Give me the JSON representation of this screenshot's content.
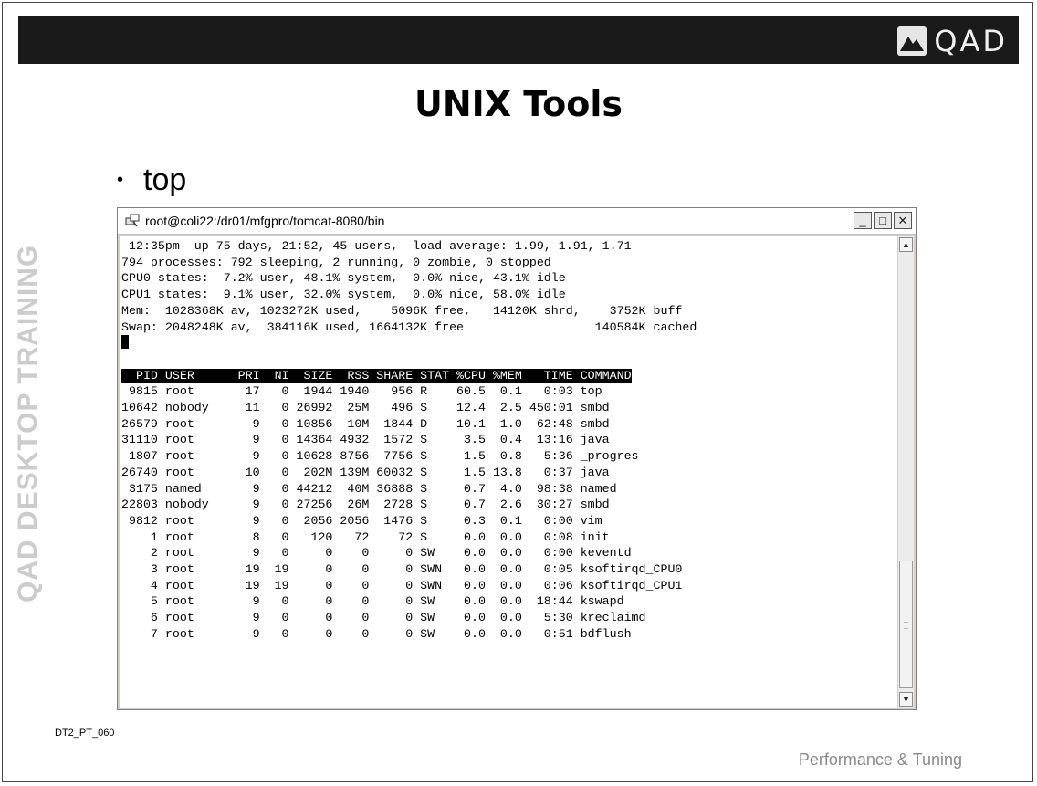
{
  "logo": {
    "text": "QAD",
    "icon": "qad-mountain-icon"
  },
  "slide": {
    "title": "UNIX Tools",
    "bullet": "top",
    "side_label": "QAD DESKTOP TRAINING",
    "footer_code": "DT2_PT_060",
    "footer_course": "Performance & Tuning"
  },
  "window": {
    "title": "root@coli22:/dr01/mfgpro/tomcat-8080/bin",
    "icon": "putty-icon",
    "buttons": {
      "minimize": "_",
      "maximize": "□",
      "close": "✕"
    }
  },
  "terminal": {
    "summary": [
      " 12:35pm  up 75 days, 21:52, 45 users,  load average: 1.99, 1.91, 1.71",
      "794 processes: 792 sleeping, 2 running, 0 zombie, 0 stopped",
      "CPU0 states:  7.2% user, 48.1% system,  0.0% nice, 43.1% idle",
      "CPU1 states:  9.1% user, 32.0% system,  0.0% nice, 58.0% idle",
      "Mem:  1028368K av, 1023272K used,    5096K free,   14120K shrd,    3752K buff",
      "Swap: 2048248K av,  384116K used, 1664132K free                  140584K cached"
    ],
    "header": "  PID USER      PRI  NI  SIZE  RSS SHARE STAT %CPU %MEM   TIME COMMAND",
    "processes": [
      " 9815 root       17   0  1944 1940   956 R    60.5  0.1   0:03 top",
      "10642 nobody     11   0 26992  25M   496 S    12.4  2.5 450:01 smbd",
      "26579 root        9   0 10856  10M  1844 D    10.1  1.0  62:48 smbd",
      "31110 root        9   0 14364 4932  1572 S     3.5  0.4  13:16 java",
      " 1807 root        9   0 10628 8756  7756 S     1.5  0.8   5:36 _progres",
      "26740 root       10   0  202M 139M 60032 S     1.5 13.8   0:37 java",
      " 3175 named       9   0 44212  40M 36888 S     0.7  4.0  98:38 named",
      "22803 nobody      9   0 27256  26M  2728 S     0.7  2.6  30:27 smbd",
      " 9812 root        9   0  2056 2056  1476 S     0.3  0.1   0:00 vim",
      "    1 root        8   0   120   72    72 S     0.0  0.0   0:08 init",
      "    2 root        9   0     0    0     0 SW    0.0  0.0   0:00 keventd",
      "    3 root       19  19     0    0     0 SWN   0.0  0.0   0:05 ksoftirqd_CPU0",
      "    4 root       19  19     0    0     0 SWN   0.0  0.0   0:06 ksoftirqd_CPU1",
      "    5 root        9   0     0    0     0 SW    0.0  0.0  18:44 kswapd",
      "    6 root        9   0     0    0     0 SW    0.0  0.0   5:30 kreclaimd",
      "    7 root        9   0     0    0     0 SW    0.0  0.0   0:51 bdflush"
    ]
  }
}
